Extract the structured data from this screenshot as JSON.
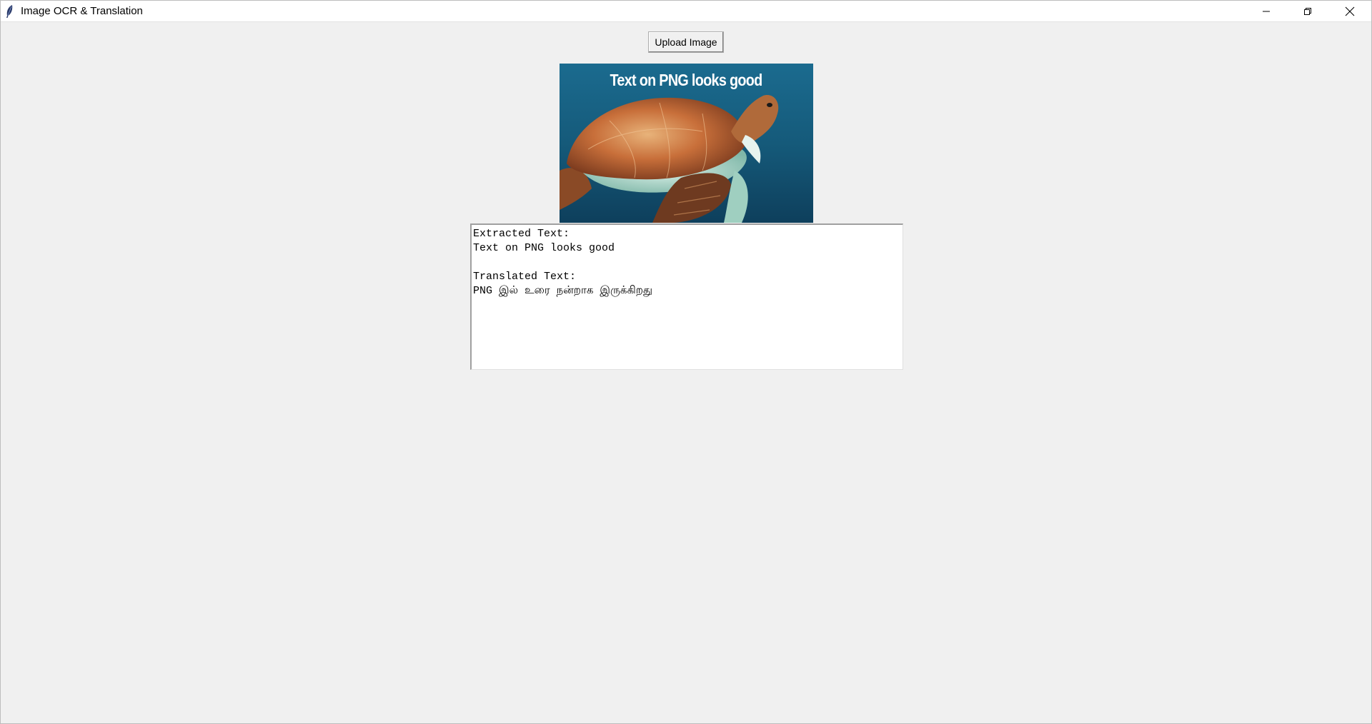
{
  "window": {
    "title": "Image OCR & Translation",
    "controls": {
      "minimize_icon": "minimize-icon",
      "maximize_icon": "restore-icon",
      "close_icon": "close-icon"
    }
  },
  "toolbar": {
    "upload_label": "Upload Image"
  },
  "image": {
    "caption": "Text on PNG looks good",
    "subject": "sea turtle",
    "background_color": "#1e6a8c"
  },
  "output": {
    "extracted_heading": "Extracted Text:",
    "extracted_text": "Text on PNG looks good",
    "blank_line": "",
    "translated_heading": "Translated Text:",
    "translated_text": "PNG இல் உரை நன்றாக இருக்கிறது"
  }
}
